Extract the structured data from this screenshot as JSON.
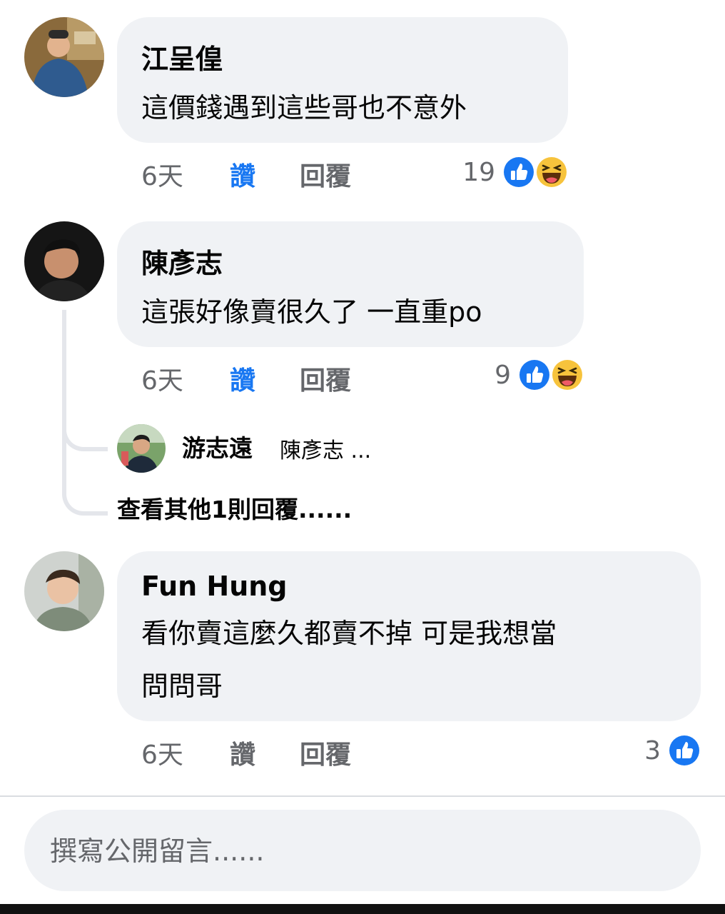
{
  "comments": [
    {
      "author": "江呈偟",
      "text_lines": [
        "這價錢遇到這些哥也不意外"
      ],
      "time": "6天",
      "like_label": "讚",
      "reply_label": "回覆",
      "reaction_count": "19",
      "reactions": [
        "like-icon",
        "haha-icon"
      ],
      "liked": true
    },
    {
      "author": "陳彥志",
      "text_lines": [
        "這張好像賣很久了 一直重po"
      ],
      "time": "6天",
      "like_label": "讚",
      "reply_label": "回覆",
      "reaction_count": "9",
      "reactions": [
        "like-icon",
        "haha-icon"
      ],
      "liked": true,
      "reply_preview": {
        "author": "游志遠",
        "snippet": "陳彥志 ..."
      },
      "more_replies": "查看其他1則回覆......"
    },
    {
      "author": "Fun Hung",
      "text_lines": [
        "看你賣這麼久都賣不掉 可是我想當",
        "問問哥"
      ],
      "time": "6天",
      "like_label": "讚",
      "reply_label": "回覆",
      "reaction_count": "3",
      "reactions": [
        "like-icon"
      ],
      "liked": false
    }
  ],
  "composer": {
    "placeholder": "撰寫公開留言......"
  },
  "colors": {
    "bubble": "#f0f2f5",
    "like_blue": "#1877f2",
    "secondary_text": "#65676b",
    "haha_yellow": "#f7c33c"
  }
}
